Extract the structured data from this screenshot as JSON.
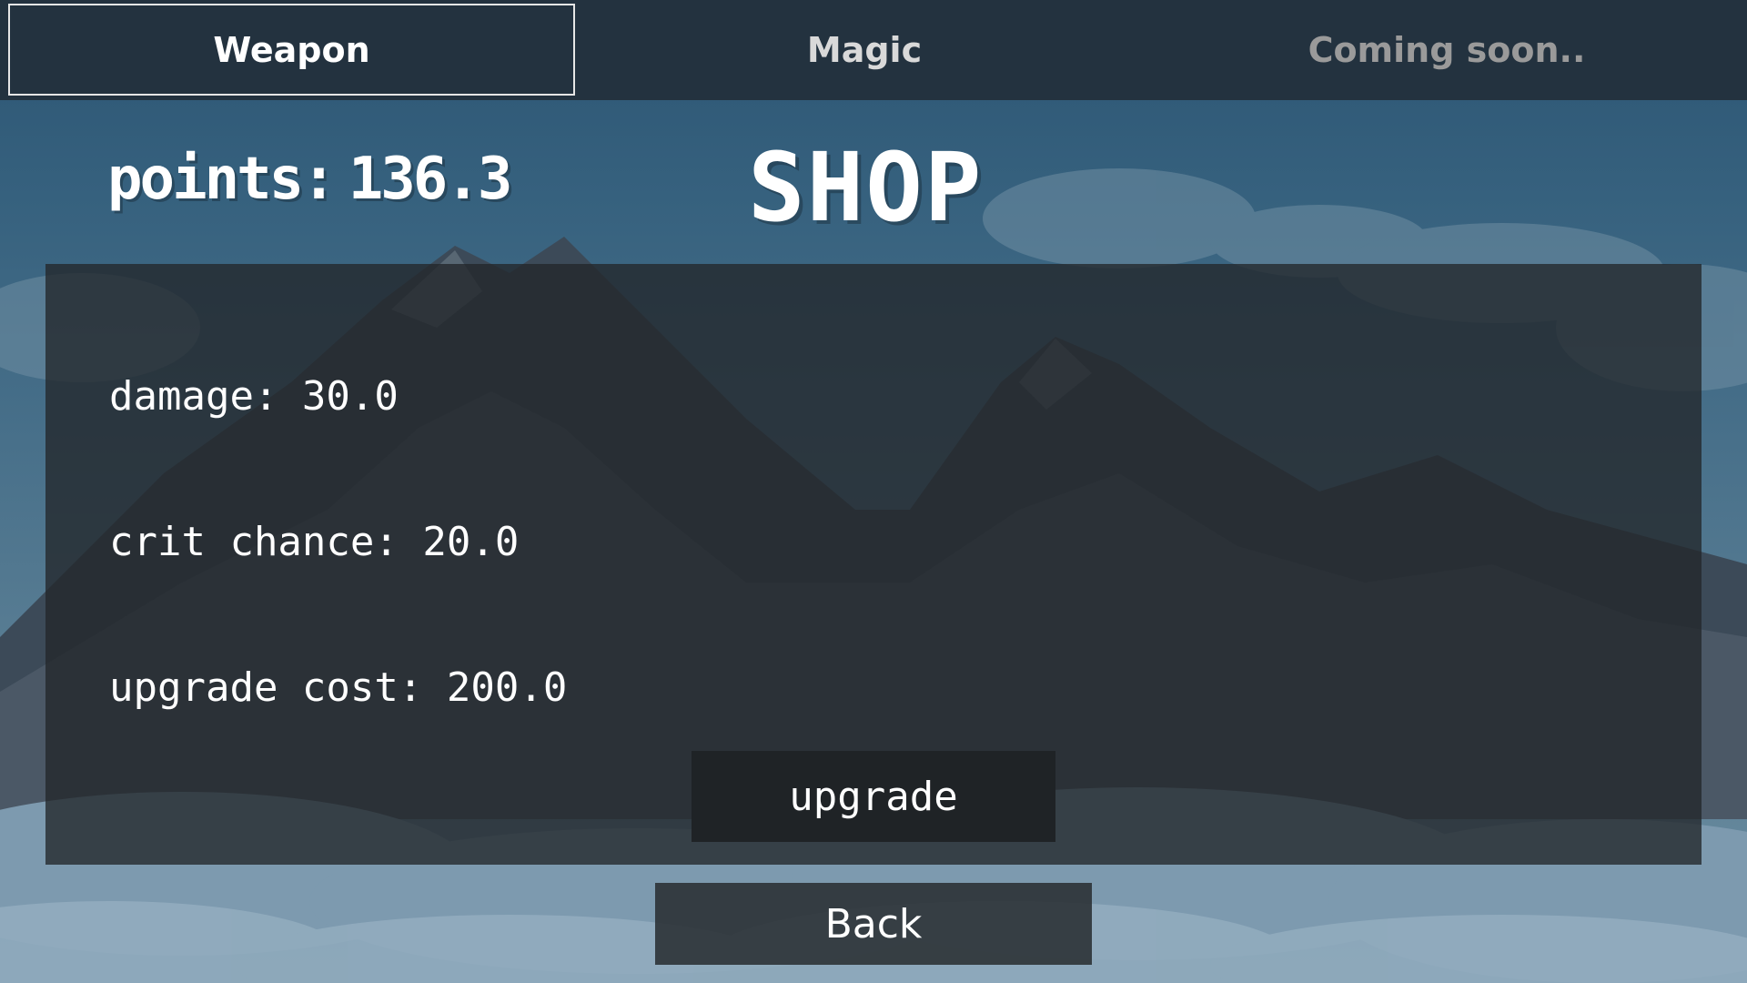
{
  "tabs": [
    {
      "label": "Weapon",
      "state": "selected"
    },
    {
      "label": "Magic",
      "state": "normal"
    },
    {
      "label": "Coming soon..",
      "state": "disabled"
    }
  ],
  "header": {
    "points_label": "points:",
    "points_value": "136.3",
    "title": "SHOP"
  },
  "stats": {
    "damage": "damage: 30.0",
    "crit_chance": "crit chance: 20.0",
    "upgrade_cost": "upgrade cost: 200.0"
  },
  "buttons": {
    "upgrade": "upgrade",
    "back": "Back"
  },
  "colors": {
    "tab_bar": "#23323f",
    "sky_top": "#2c5573",
    "panel": "#23262a",
    "text": "#ffffff"
  }
}
